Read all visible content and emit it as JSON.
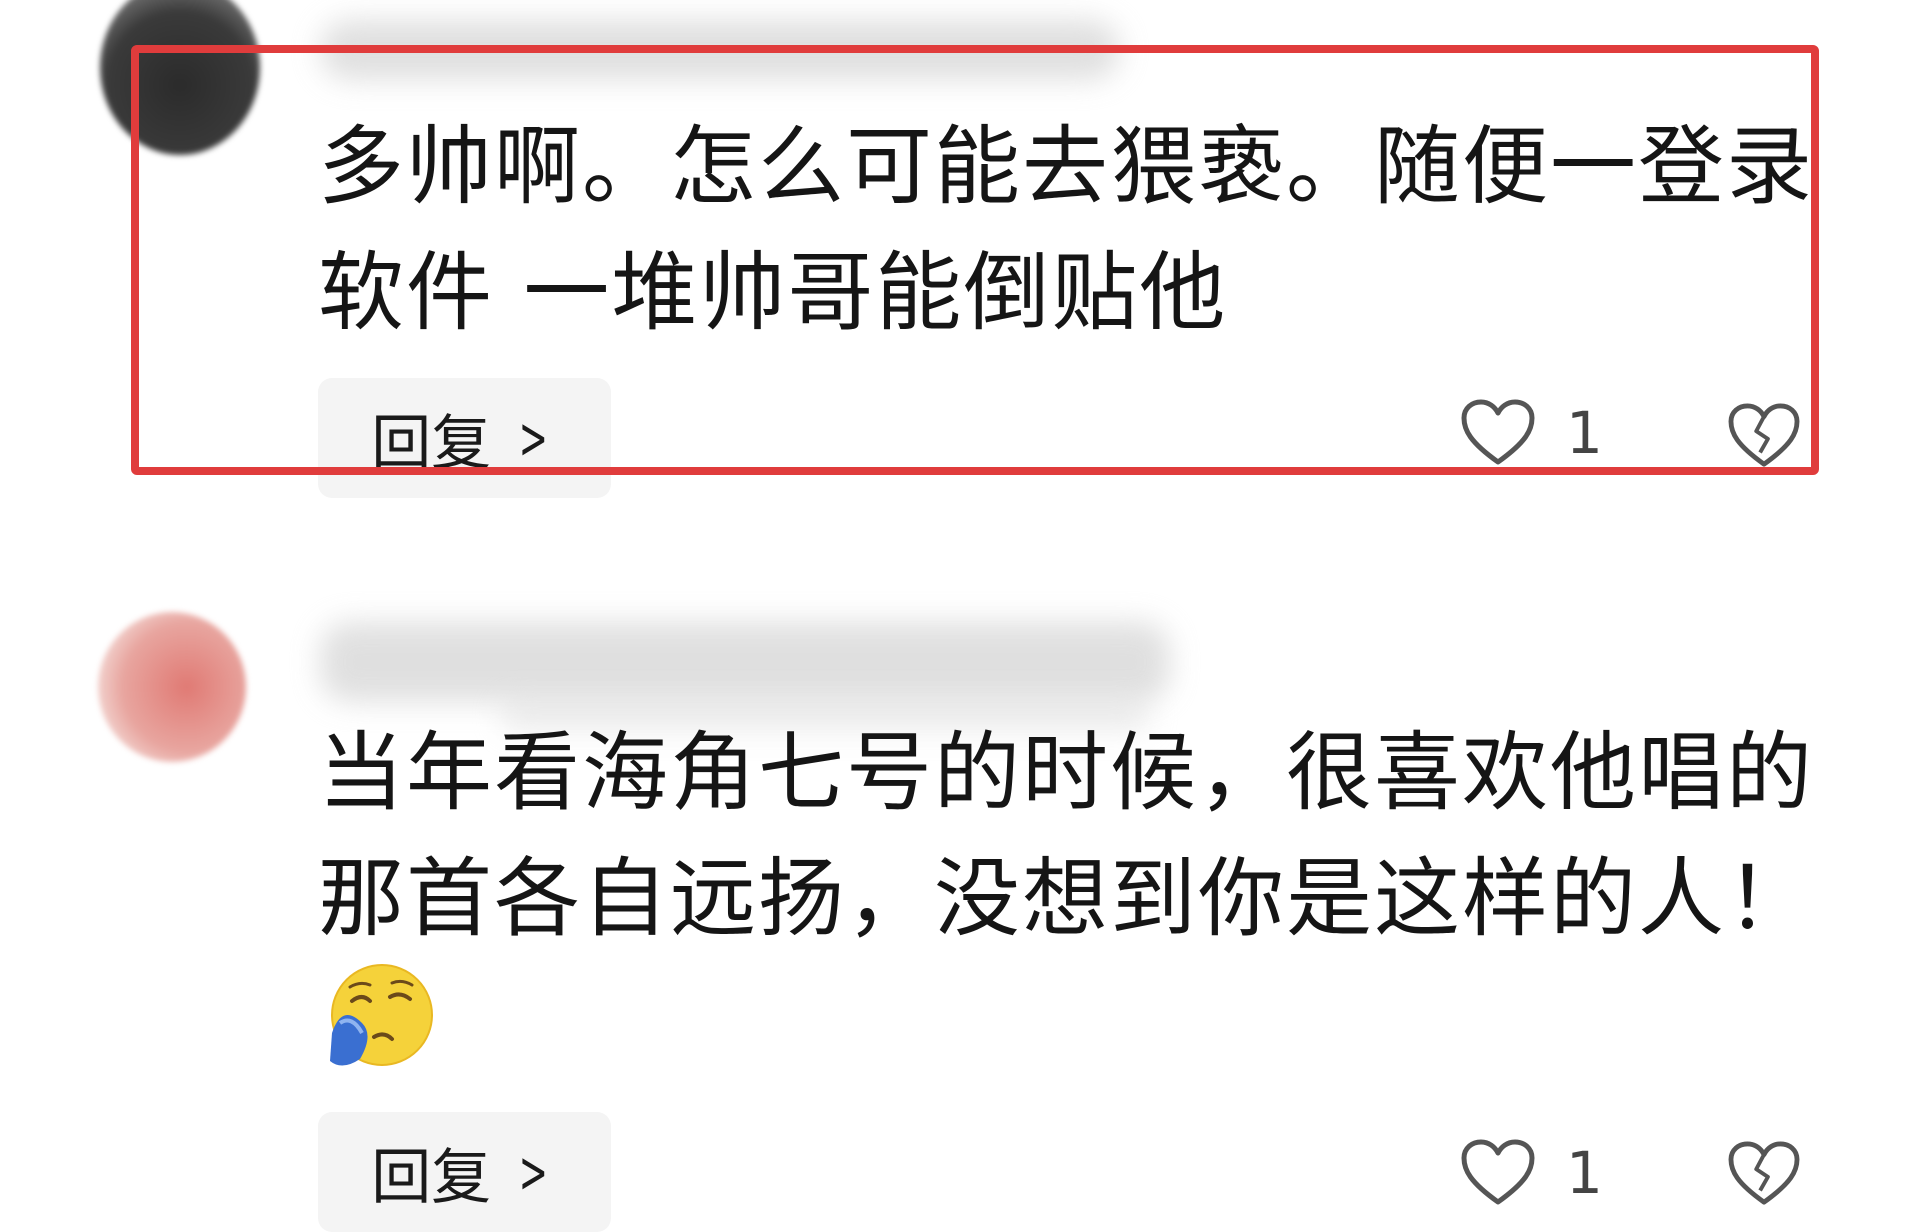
{
  "comments": [
    {
      "text": "多帅啊。怎么可能去猥亵。随便一登录\n软件 一堆帅哥能倒贴他",
      "reply_label": "回复",
      "likes": "1"
    },
    {
      "text": "当年看海角七号的时候，很喜欢他唱的\n那首各自远扬，没想到你是这样的人！",
      "reply_label": "回复",
      "likes": "1"
    }
  ],
  "colors": {
    "highlight": "#e03c3c",
    "reply_bg": "#f4f4f4"
  },
  "icons": [
    "heart-icon",
    "broken-heart-icon",
    "chevron-right-icon",
    "crying-emoji"
  ]
}
